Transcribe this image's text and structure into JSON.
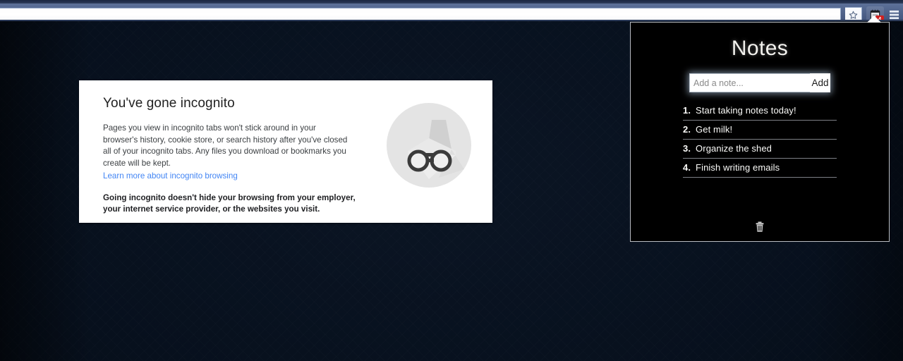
{
  "browser": {
    "omnibox": {
      "value": "",
      "placeholder": ""
    },
    "bookmark_icon": "star-icon",
    "extension": {
      "icon": "notepad-icon",
      "badge_text": "4",
      "badge_color": "#cf2020"
    },
    "menu_icon": "hamburger-menu-icon"
  },
  "incognito_page": {
    "title": "You've gone incognito",
    "paragraph": "Pages you view in incognito tabs won't stick around in your browser's history, cookie store, or search history after you've closed all of your incognito tabs. Any files you download or bookmarks you create will be kept.",
    "learn_more_link": "Learn more about incognito browsing",
    "learn_more_color": "#4285f4",
    "warning": "Going incognito doesn't hide your browsing from your employer, your internet service provider, or the websites you visit.",
    "glyph_icon": "incognito-hat-glasses-icon",
    "background_color": "#07101d",
    "card_color": "#ffffff"
  },
  "notes_popup": {
    "heading": "Notes",
    "input": {
      "value": "",
      "placeholder": "Add a note..."
    },
    "add_button_label": "Add",
    "delete_icon": "trash-icon",
    "background_color": "#000000",
    "border_color": "#b9bcc2",
    "notes": [
      {
        "index": "1.",
        "text": "Start taking notes today!"
      },
      {
        "index": "2.",
        "text": "Get milk!"
      },
      {
        "index": "3.",
        "text": "Organize the shed"
      },
      {
        "index": "4.",
        "text": "Finish writing emails"
      }
    ]
  }
}
